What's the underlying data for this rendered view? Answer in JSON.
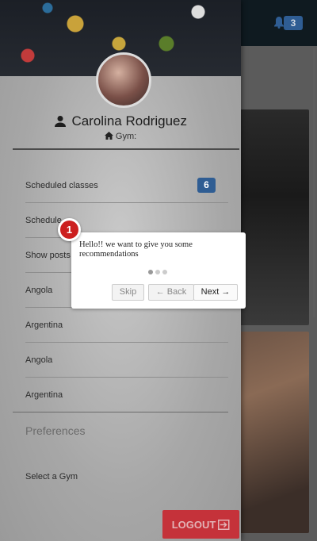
{
  "header": {
    "notifications_count": "3"
  },
  "drawer": {
    "user_name": "Carolina Rodriguez",
    "gym_label": "Gym:",
    "menu": [
      {
        "label": "Scheduled classes",
        "badge": "6"
      },
      {
        "label": "Schedule"
      },
      {
        "label": "Show posts"
      },
      {
        "label": "Angola"
      },
      {
        "label": "Argentina"
      },
      {
        "label": "Angola"
      },
      {
        "label": "Argentina"
      }
    ],
    "preferences_label": "Preferences",
    "select_gym_label": "Select a Gym",
    "logout_label": "LOGOUT"
  },
  "tour": {
    "step": "1",
    "message": "Hello!! we want to give you some recommendations",
    "total_steps": 3,
    "current_step": 1,
    "skip_label": "Skip",
    "back_label": "← Back",
    "next_label": "Next →"
  },
  "colors": {
    "badge": "#2f5d93",
    "logout": "#c5323a",
    "step_marker": "#cc1f1f"
  }
}
